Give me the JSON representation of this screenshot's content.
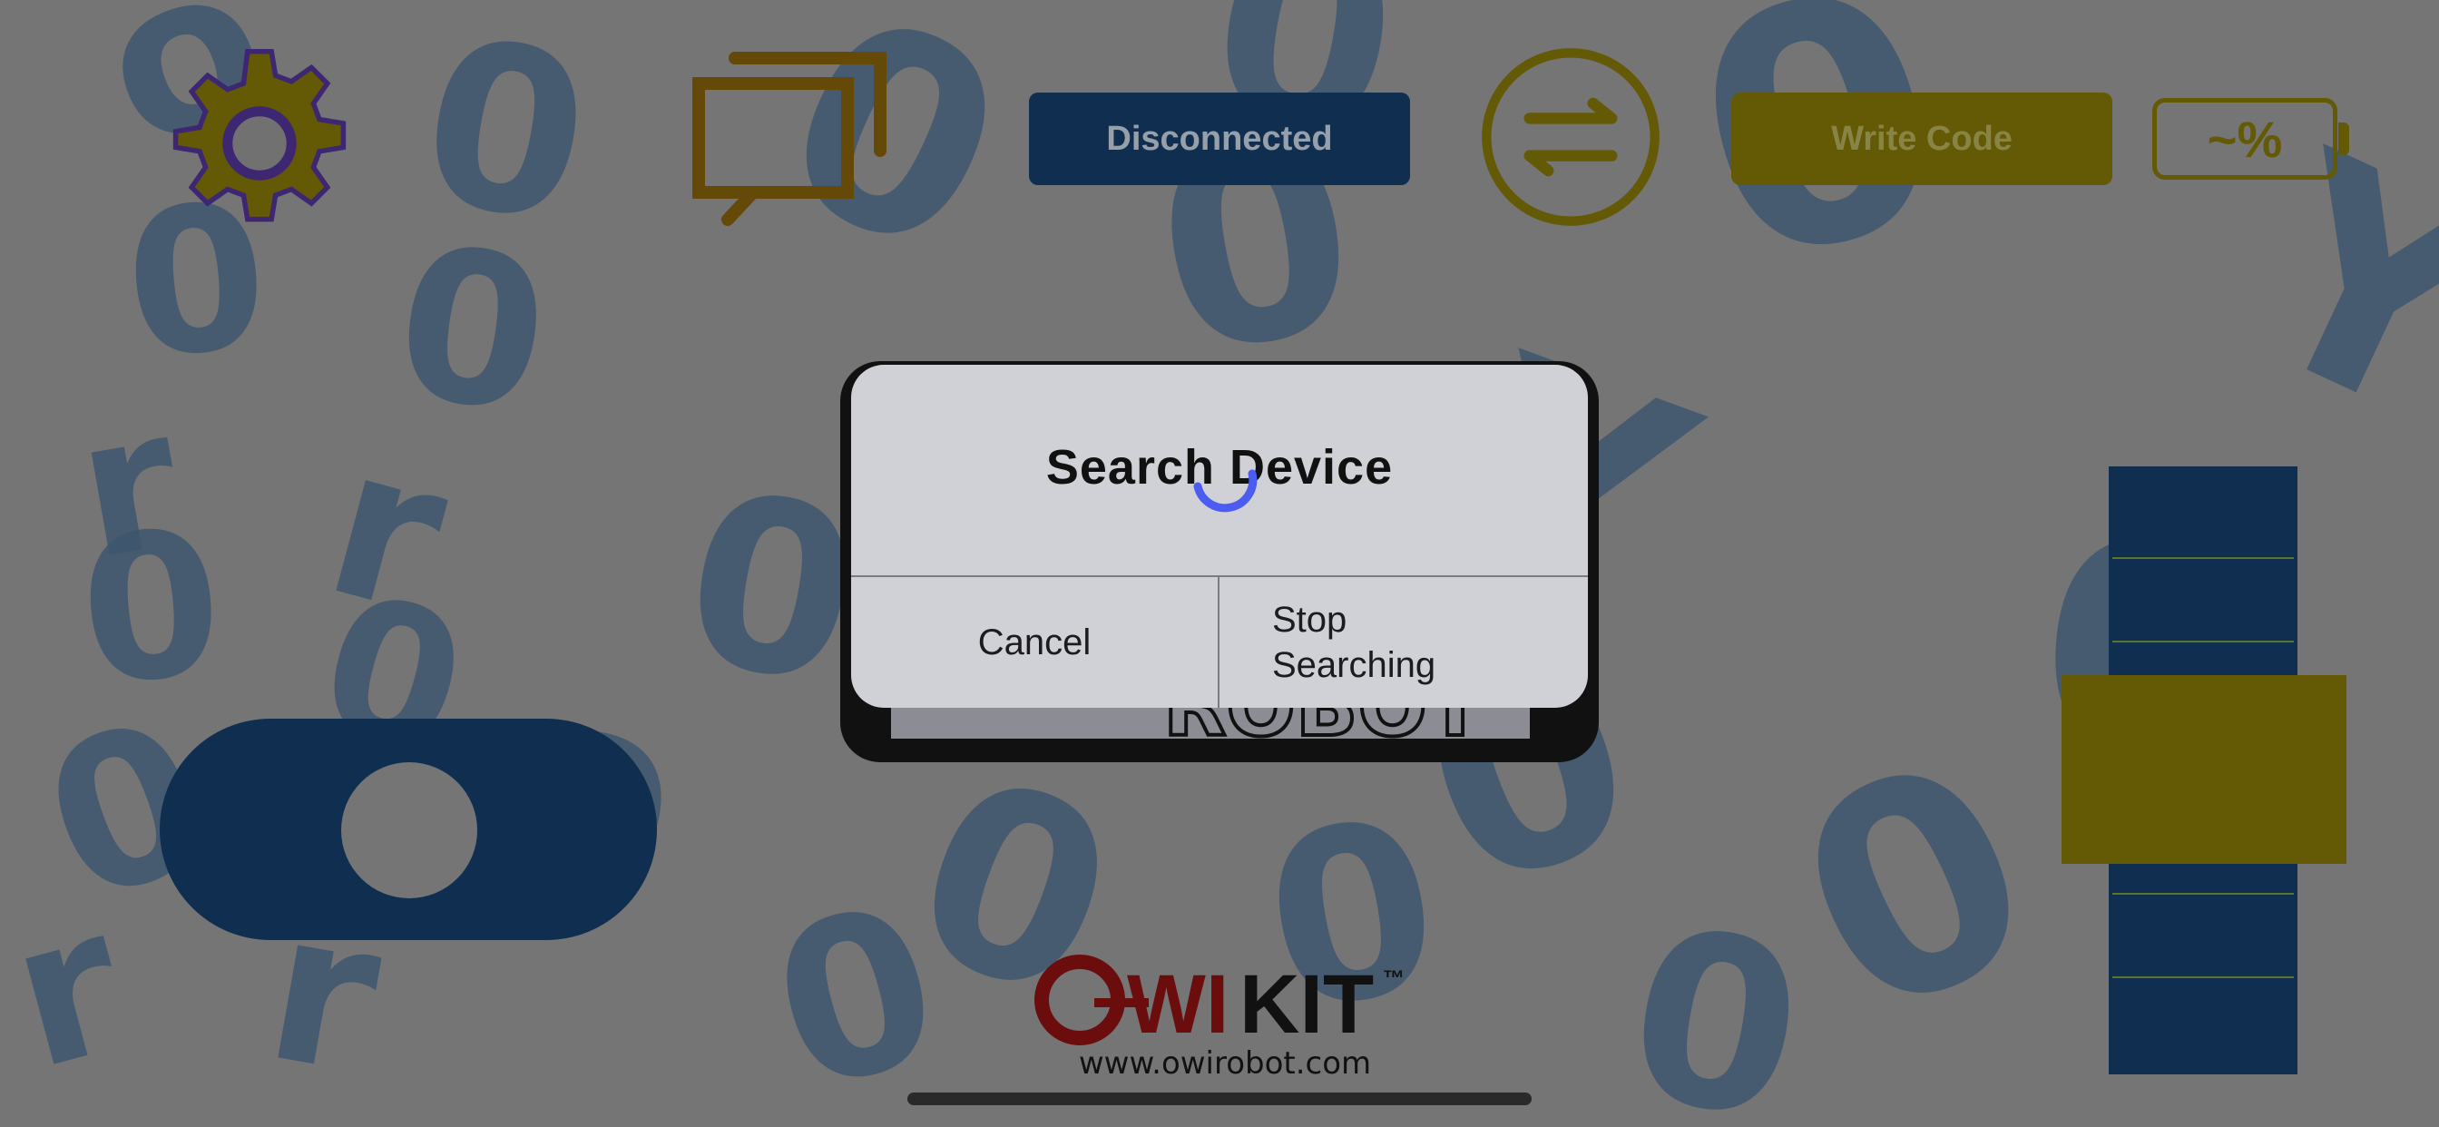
{
  "toolbar": {
    "connection_status": "Disconnected",
    "write_code_label": "Write Code",
    "battery_text": "~%"
  },
  "dialog": {
    "title": "Search Device",
    "cancel_label": "Cancel",
    "stop_label": "Stop Searching"
  },
  "logo": {
    "brand": "OWIKIT",
    "trademark": "™",
    "url": "www.owirobot.com"
  },
  "colors": {
    "accent_blue": "#143a62",
    "accent_olive": "#7a6d05",
    "spinner": "#4d5cf0",
    "gear_outline": "#4b2f8c"
  },
  "icons": [
    "settings-gear-icon",
    "windows-cascade-icon",
    "swap-arrows-icon",
    "battery-icon",
    "loading-spinner-icon"
  ]
}
